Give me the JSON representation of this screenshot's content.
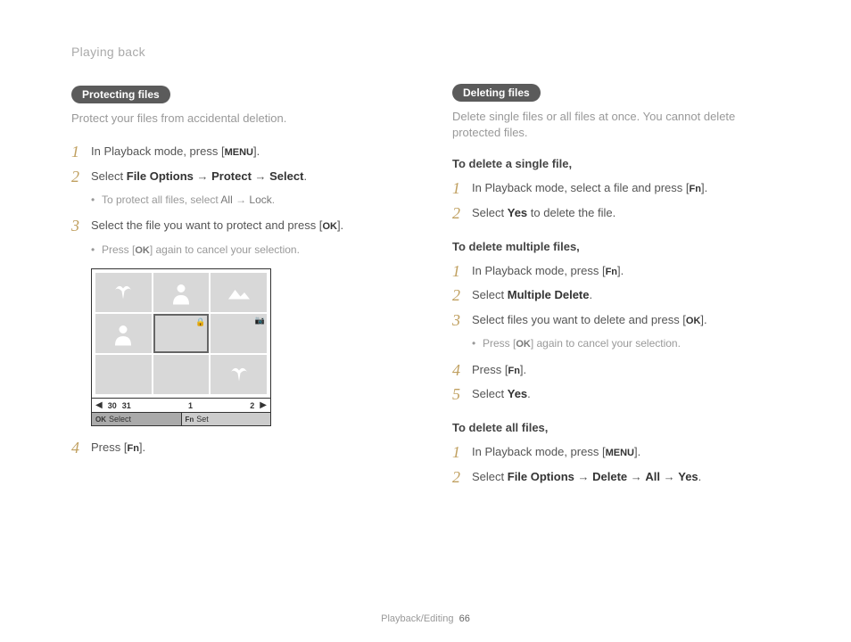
{
  "header": "Playing back",
  "footer": {
    "section": "Playback/Editing",
    "page": "66"
  },
  "left": {
    "pill": "Protecting files",
    "intro": "Protect your files from accidental deletion.",
    "step1_pre": "In Playback mode, press [",
    "step1_key": "MENU",
    "step1_post": "].",
    "step2_a": "Select ",
    "step2_b": "File Options",
    "step2_arr1": " → ",
    "step2_c": "Protect",
    "step2_arr2": " → ",
    "step2_d": "Select",
    "step2_e": ".",
    "bullet2_a": "To protect all files, select ",
    "bullet2_b": "All",
    "bullet2_arr": " → ",
    "bullet2_c": "Lock",
    "bullet2_d": ".",
    "step3_pre": "Select the file you want to protect and press [",
    "step3_key": "OK",
    "step3_post": "].",
    "bullet3_a": "Press [",
    "bullet3_key": "OK",
    "bullet3_b": "] again to cancel your selection.",
    "step4_pre": "Press [",
    "step4_key": "Fn",
    "step4_post": "].",
    "cal": {
      "d1": "30",
      "d2": "31",
      "d3": "1",
      "d4": "2"
    },
    "gridbar": {
      "k1": "OK",
      "v1": "Select",
      "k2": "Fn",
      "v2": "Set"
    }
  },
  "right": {
    "pill": "Deleting files",
    "intro": "Delete single files or all files at once. You cannot delete protected files.",
    "sub1": "To delete a single file,",
    "s1_step1_pre": "In Playback mode, select a file and press [",
    "s1_step1_key": "Fn",
    "s1_step1_post": "].",
    "s1_step2_a": "Select ",
    "s1_step2_b": "Yes",
    "s1_step2_c": " to delete the file.",
    "sub2": "To delete multiple files,",
    "s2_step1_pre": "In Playback mode, press [",
    "s2_step1_key": "Fn",
    "s2_step1_post": "].",
    "s2_step2_a": "Select ",
    "s2_step2_b": "Multiple Delete",
    "s2_step2_c": ".",
    "s2_step3_pre": "Select files you want to delete and press [",
    "s2_step3_key": "OK",
    "s2_step3_post": "].",
    "s2_bullet_a": "Press [",
    "s2_bullet_key": "OK",
    "s2_bullet_b": "] again to cancel your selection.",
    "s2_step4_pre": "Press [",
    "s2_step4_key": "Fn",
    "s2_step4_post": "].",
    "s2_step5_a": "Select ",
    "s2_step5_b": "Yes",
    "s2_step5_c": ".",
    "sub3": "To delete all files,",
    "s3_step1_pre": "In Playback mode, press [",
    "s3_step1_key": "MENU",
    "s3_step1_post": "].",
    "s3_step2_a": "Select ",
    "s3_step2_b": "File Options",
    "s3_step2_arr1": " → ",
    "s3_step2_c": "Delete",
    "s3_step2_arr2": " → ",
    "s3_step2_d": "All",
    "s3_step2_arr3": " → ",
    "s3_step2_e": "Yes",
    "s3_step2_f": "."
  }
}
